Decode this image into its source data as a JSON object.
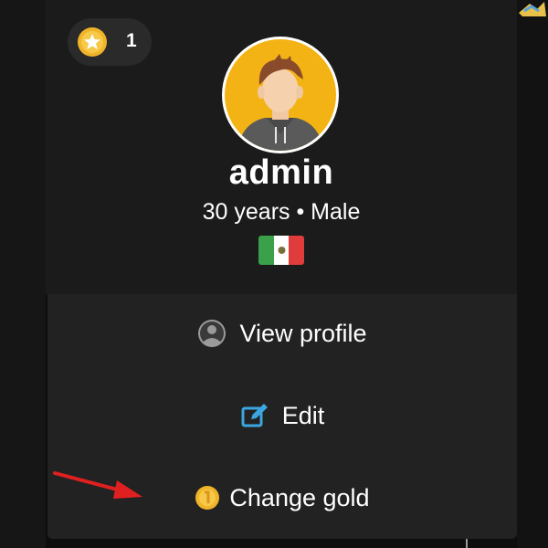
{
  "profile": {
    "level_count": "1",
    "username": "admin",
    "meta": "30 years • Male",
    "flag_colors": [
      "#3aa04a",
      "#ffffff",
      "#e03c3c"
    ]
  },
  "menu": {
    "items": [
      {
        "label": "View profile",
        "icon": "user-circle-icon"
      },
      {
        "label": "Edit",
        "icon": "edit-icon"
      },
      {
        "label": "Change gold",
        "icon": "gold-coin-icon"
      }
    ]
  },
  "colors": {
    "accent_gold": "#f0b429",
    "edit_icon": "#3ba6e0",
    "annotation_arrow": "#e02020"
  }
}
